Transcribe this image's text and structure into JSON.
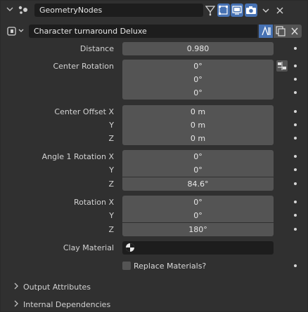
{
  "header": {
    "modifier_name": "GeometryNodes",
    "icons": [
      "collapse-chevron-icon",
      "geometry-nodes-modifier-icon",
      "on-cage-icon",
      "edit-mode-icon",
      "realtime-viewport-icon",
      "render-camera-icon",
      "dropdown-chevron-icon",
      "close-icon"
    ]
  },
  "node_group": {
    "name": "Character turnaround Deluxe",
    "icons": [
      "node-tree-icon",
      "fake-user-icon",
      "duplicate-icon",
      "unlink-x-icon"
    ]
  },
  "properties": {
    "distance": {
      "label": "Distance",
      "value": "0.980"
    },
    "center_rotation": {
      "label": "Center Rotation",
      "values": [
        "0°",
        "0°",
        "0°"
      ]
    },
    "center_offset": {
      "labels": [
        "Center Offset X",
        "Y",
        "Z"
      ],
      "values": [
        "0 m",
        "0 m",
        "0 m"
      ]
    },
    "angle1_rotation": {
      "labels": [
        "Angle 1 Rotation X",
        "Y",
        "Z"
      ],
      "values": [
        "0°",
        "0°",
        "84.6°"
      ]
    },
    "rotation": {
      "labels": [
        "Rotation X",
        "Y",
        "Z"
      ],
      "values": [
        "0°",
        "0°",
        "180°"
      ]
    },
    "clay_material": {
      "label": "Clay Material",
      "value": ""
    },
    "replace_materials": {
      "label": "Replace Materials?",
      "checked": false
    }
  },
  "subpanels": [
    {
      "label": "Output Attributes",
      "expanded": false
    },
    {
      "label": "Internal Dependencies",
      "expanded": false
    }
  ],
  "colors": {
    "background": "#303030",
    "field": "#545454",
    "dark_field": "#1d1d1d",
    "selected": "#4772b3"
  }
}
